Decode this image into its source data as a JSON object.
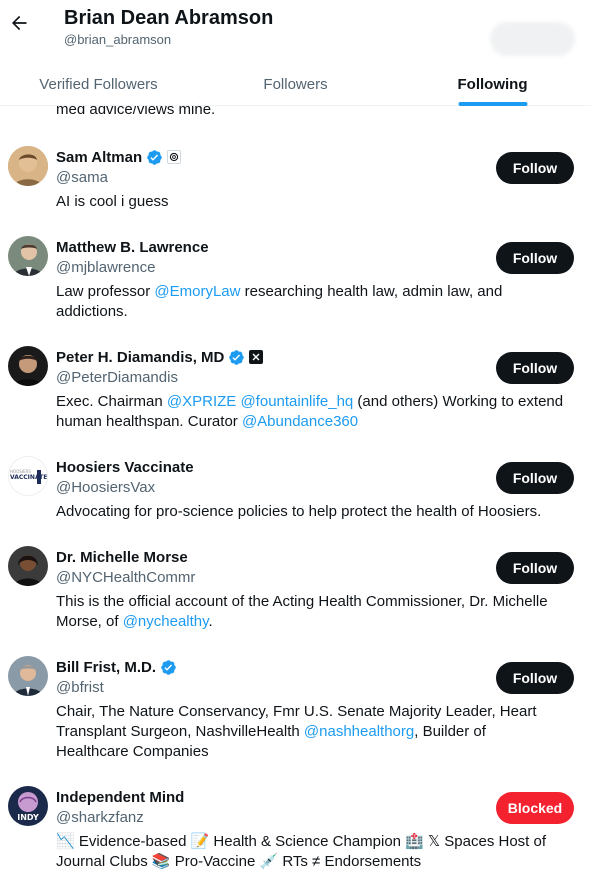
{
  "header": {
    "title": "Brian Dean Abramson",
    "handle": "@brian_abramson"
  },
  "tabs": [
    {
      "label": "Verified Followers",
      "active": false
    },
    {
      "label": "Followers",
      "active": false
    },
    {
      "label": "Following",
      "active": true
    }
  ],
  "partial_bio": "med advice/views mine.",
  "users": [
    {
      "name": "Sam Altman",
      "handle": "@sama",
      "verified": true,
      "affiliation_icon": "openai-icon",
      "bio": [
        "AI is cool i guess"
      ],
      "button": "Follow"
    },
    {
      "name": "Matthew B. Lawrence",
      "handle": "@mjblawrence",
      "verified": false,
      "bio_parts": {
        "a": "Law professor ",
        "m1": "@EmoryLaw",
        "b": " researching health law, admin law, and",
        "c": "addictions."
      },
      "button": "Follow"
    },
    {
      "name": "Peter H. Diamandis, MD",
      "handle": "@PeterDiamandis",
      "verified": true,
      "affiliation_icon": "x-logo-icon",
      "bio_parts": {
        "a": "Exec. Chairman ",
        "m1": "@XPRIZE",
        "m2": "@fountainlife_hq",
        "b": " (and others) Working to extend",
        "c": "human healthspan. Curator ",
        "m3": "@Abundance360"
      },
      "button": "Follow"
    },
    {
      "name": "Hoosiers Vaccinate",
      "handle": "@HoosiersVax",
      "verified": false,
      "bio": [
        "Advocating for pro-science policies to help protect the health of Hoosiers."
      ],
      "avatar_text": "VACCINATE",
      "avatar_subtext": "HOOSIERS",
      "button": "Follow"
    },
    {
      "name": "Dr. Michelle Morse",
      "handle": "@NYCHealthCommr",
      "verified": false,
      "bio_parts": {
        "a": "This is the official account of the Acting Health Commissioner, Dr. Michelle",
        "b": "Morse, of ",
        "m1": "@nychealthy",
        "c": "."
      },
      "button": "Follow"
    },
    {
      "name": "Bill Frist, M.D.",
      "handle": "@bfrist",
      "verified": true,
      "bio_parts": {
        "a": "Chair, The Nature Conservancy, Fmr U.S. Senate Majority Leader, Heart",
        "b": "Transplant Surgeon, NashvilleHealth ",
        "m1": "@nashhealthorg",
        "c": ", Builder of",
        "d": "Healthcare Companies"
      },
      "button": "Follow"
    },
    {
      "name": "Independent Mind",
      "handle": "@sharkzfanz",
      "verified": false,
      "avatar_text": "INDY",
      "bio_parts": {
        "a": "📉 Evidence-based 📝 Health & Science Champion 🏥 𝕏 Spaces Host of",
        "b": "Journal Clubs 📚 Pro-Vaccine 💉 RTs ≠ Endorsements"
      },
      "button": "Blocked"
    }
  ],
  "colors": {
    "accent": "#1d9bf0",
    "text": "#0f1419",
    "muted": "#536471",
    "blocked": "#f4212e"
  }
}
